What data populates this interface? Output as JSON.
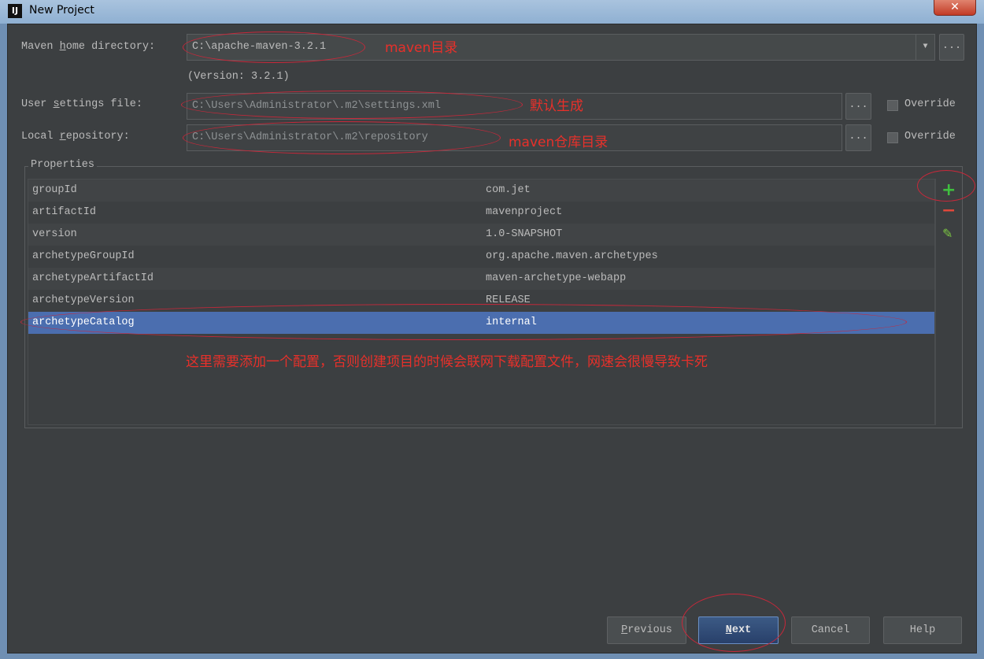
{
  "window": {
    "title": "New Project",
    "logo": "IJ",
    "close_icon": "close-icon"
  },
  "maven_home": {
    "label_pre": "Maven ",
    "label_u": "h",
    "label_post": "ome directory:",
    "value": "C:\\apache-maven-3.2.1",
    "version": "(Version: 3.2.1)",
    "browse": "..."
  },
  "user_settings": {
    "label_pre": "User ",
    "label_u": "s",
    "label_post": "ettings file:",
    "value": "C:\\Users\\Administrator\\.m2\\settings.xml",
    "browse": "...",
    "override": "Override",
    "override_checked": false
  },
  "local_repo": {
    "label_pre": "Local ",
    "label_u": "r",
    "label_post": "epository:",
    "value": "C:\\Users\\Administrator\\.m2\\repository",
    "browse": "...",
    "override": "Override",
    "override_checked": false
  },
  "properties": {
    "title": "Properties",
    "rows": [
      {
        "key": "groupId",
        "value": "com.jet"
      },
      {
        "key": "artifactId",
        "value": "mavenproject"
      },
      {
        "key": "version",
        "value": "1.0-SNAPSHOT"
      },
      {
        "key": "archetypeGroupId",
        "value": "org.apache.maven.archetypes"
      },
      {
        "key": "archetypeArtifactId",
        "value": "maven-archetype-webapp"
      },
      {
        "key": "archetypeVersion",
        "value": "RELEASE"
      },
      {
        "key": "archetypeCatalog",
        "value": "internal",
        "selected": true
      }
    ],
    "toolbar": {
      "add": "+",
      "remove": "−",
      "edit": "✎"
    }
  },
  "annotations": {
    "maven_home": "maven目录",
    "settings": "默认生成",
    "repo": "maven仓库目录",
    "catalog": "这里需要添加一个配置，否则创建项目的时候会联网下载配置文件，网速会很慢导致卡死",
    "color": "#e8302a"
  },
  "buttons": {
    "previous_u": "P",
    "previous": "revious",
    "next_u": "N",
    "next": "ext",
    "cancel": "Cancel",
    "help": "Help"
  },
  "colors": {
    "background": "#3c3f41",
    "selection": "#4b6eaf",
    "add": "#3fbf3f",
    "remove": "#e0483a"
  }
}
